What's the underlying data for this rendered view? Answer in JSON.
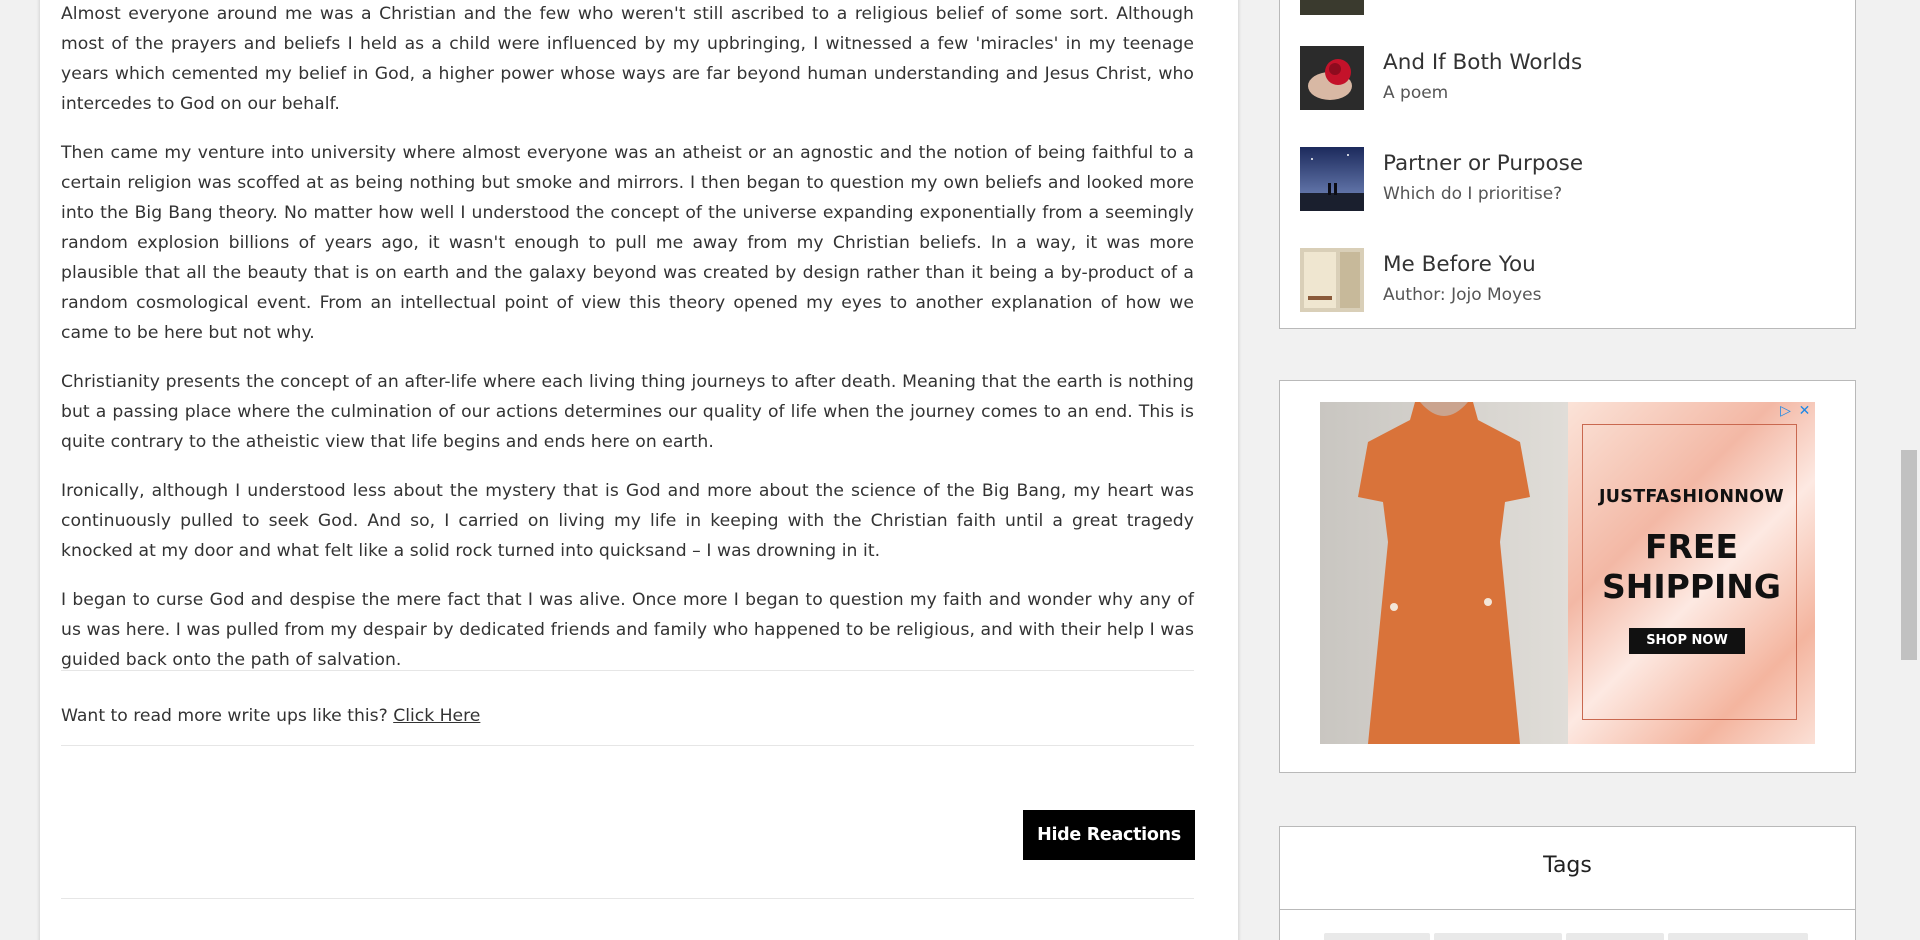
{
  "article": {
    "paragraphs": [
      "Almost everyone around me was a Christian and the few who weren't still ascribed to a religious belief of some sort. Although most of the prayers and beliefs I held as a child were influenced by my upbringing, I witnessed a few 'miracles' in my teenage years which cemented my belief in God, a higher power whose ways are far beyond human understanding and Jesus Christ, who intercedes to God on our behalf.",
      "Then came my venture into university where almost everyone was an atheist or an agnostic and the notion of being faithful to a certain religion was scoffed at as being nothing but smoke and mirrors. I then began to question my own beliefs and looked more into the Big Bang theory. No matter how well I understood the concept of the universe expanding exponentially from a seemingly random explosion billions of years ago, it wasn't enough to pull me away from my Christian beliefs. In a way, it was more plausible that all the beauty that is on earth and the galaxy beyond was created by design rather than it being a by-product of a random cosmological event. From an intellectual point of view this theory opened my eyes to another explanation of how we came to be here but not why.",
      "Christianity presents the concept of an after-life where each living thing journeys to after death. Meaning that the earth is nothing but a passing place where the culmination of our actions determines our quality of life when the journey comes to an end. This is quite contrary to the atheistic view that life begins and ends here on earth.",
      "Ironically, although I understood less about the mystery that is God and more about the science of the Big Bang, my heart was continuously pulled to seek God. And so, I carried on living my life in keeping with the Christian faith until a great tragedy knocked at my door and what felt like a solid rock turned into quicksand – I was drowning in it.",
      "I began to curse God and despise the mere fact that I was alive. Once more I began to question my faith and wonder why any of us was here. I was pulled from my despair by dedicated friends and family who happened to be religious, and with their help I was guided back onto the path of salvation."
    ],
    "read_more_prompt": "Want to read more write ups like this?",
    "read_more_link": "Click Here",
    "hide_reactions_label": "Hide Reactions"
  },
  "sidebar": {
    "related": [
      {
        "title": "And If Both Worlds",
        "subtitle": "A poem",
        "thumb_icon": "red-rose-hand-image"
      },
      {
        "title": "Partner or Purpose",
        "subtitle": "Which do I prioritise?",
        "thumb_icon": "night-sky-couple-image"
      },
      {
        "title": "Me Before You",
        "subtitle": "Author: Jojo Moyes",
        "thumb_icon": "book-cover-image"
      }
    ],
    "ad": {
      "brand": "JUSTFASHIONNOW",
      "headline_line1": "FREE",
      "headline_line2": "SHIPPING",
      "cta": "SHOP NOW",
      "accent": "#1e88e5"
    },
    "tags_title": "Tags"
  }
}
